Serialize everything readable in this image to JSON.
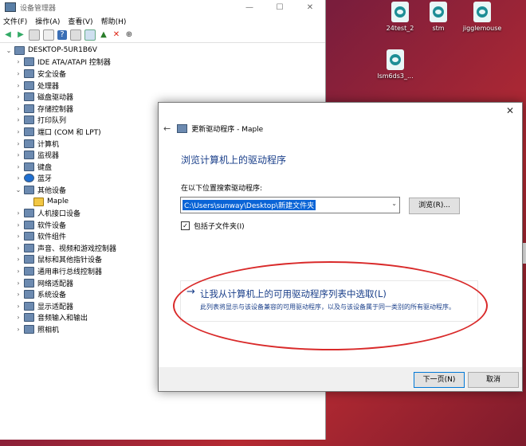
{
  "desktop": {
    "icons": [
      {
        "label": "24test_2"
      },
      {
        "label": "stm"
      },
      {
        "label": "jigglemouse"
      },
      {
        "label": "lsm6ds3_..."
      }
    ]
  },
  "device_manager": {
    "title": "设备管理器",
    "menu": [
      "文件(F)",
      "操作(A)",
      "查看(V)",
      "帮助(H)"
    ],
    "tree_root": "DESKTOP-5UR1B6V",
    "tree_items": [
      {
        "label": "IDE ATA/ATAPI 控制器"
      },
      {
        "label": "安全设备"
      },
      {
        "label": "处理器"
      },
      {
        "label": "磁盘驱动器"
      },
      {
        "label": "存储控制器"
      },
      {
        "label": "打印队列"
      },
      {
        "label": "端口 (COM 和 LPT)"
      },
      {
        "label": "计算机"
      },
      {
        "label": "监视器"
      },
      {
        "label": "键盘"
      },
      {
        "label": "蓝牙"
      },
      {
        "label": "其他设备"
      },
      {
        "label": "Maple"
      },
      {
        "label": "人机接口设备"
      },
      {
        "label": "软件设备"
      },
      {
        "label": "软件组件"
      },
      {
        "label": "声音、视频和游戏控制器"
      },
      {
        "label": "鼠标和其他指针设备"
      },
      {
        "label": "通用串行总线控制器"
      },
      {
        "label": "网络适配器"
      },
      {
        "label": "系统设备"
      },
      {
        "label": "显示适配器"
      },
      {
        "label": "音频输入和输出"
      },
      {
        "label": "照相机"
      }
    ]
  },
  "wizard": {
    "title": "更新驱动程序 - Maple",
    "heading": "浏览计算机上的驱动程序",
    "search_label": "在以下位置搜索驱动程序:",
    "path_value": "C:\\Users\\sunway\\Desktop\\新建文件夹",
    "browse_label": "浏览(R)...",
    "include_subfolders": "包括子文件夹(I)",
    "pick_title": "让我从计算机上的可用驱动程序列表中选取(L)",
    "pick_desc": "此列表将显示与该设备兼容的可用驱动程序，以及与该设备属于同一类别的所有驱动程序。",
    "next_label": "下一页(N)",
    "cancel_label": "取消"
  },
  "right_edge_text": "建文"
}
